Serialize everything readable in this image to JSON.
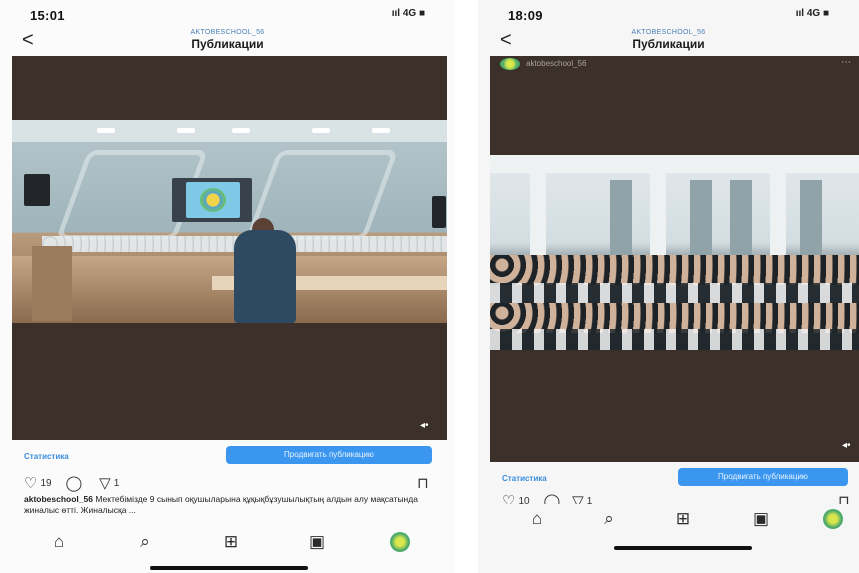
{
  "left": {
    "status": {
      "time": "15:01",
      "icons": "ııl 4G ■"
    },
    "header": {
      "back": "<",
      "username": "AKTOBESCHOOL_56",
      "title": "Публикации"
    },
    "sound_icon": "◂•",
    "stats_label": "Статистика",
    "promote_label": "Продвигать публикацию",
    "likes": "19",
    "comments": "",
    "shares": "1",
    "caption_user": "aktobeschool_56",
    "caption_text": "Мектебімізде 9 сынып оқушыларына құқықбұзушылықтың алдын алу мақсатында жиналыс өтті. Жиналысқа ...",
    "icons": {
      "like": "heart-icon",
      "comment": "comment-icon",
      "share": "share-icon",
      "bookmark": "bookmark-icon",
      "home": "home-icon",
      "search": "search-icon",
      "add": "add-icon",
      "reels": "reels-icon",
      "profile": "avatar"
    }
  },
  "right": {
    "status": {
      "time": "18:09",
      "icons": "ııl 4G ■"
    },
    "header": {
      "back": "<",
      "username": "AKTOBESCHOOL_56",
      "title": "Публикации"
    },
    "feed_username": "aktobeschool_56",
    "feed_more": "⋯",
    "sound_icon": "◂•",
    "stats_label": "Статистика",
    "promote_label": "Продвигать публикацию",
    "likes": "10",
    "shares": "1"
  },
  "colors": {
    "accent": "#3b96f0",
    "link": "#3a8dde",
    "media_bg": "#3b302a"
  }
}
